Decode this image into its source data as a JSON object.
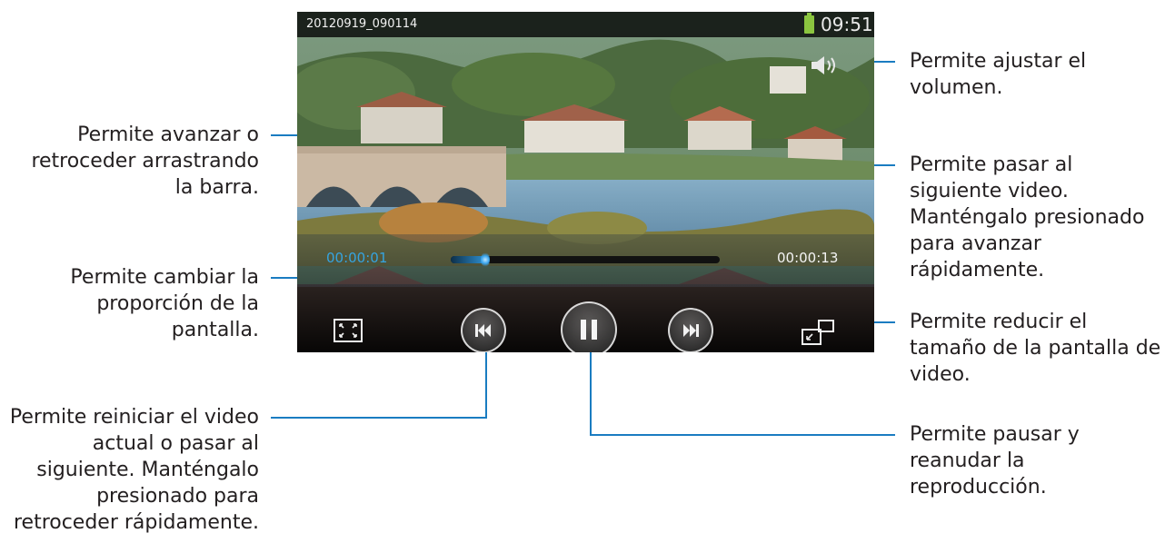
{
  "video": {
    "filename": "20120919_090114",
    "clock": "09:51",
    "current_time": "00:00:01",
    "total_time": "00:00:13",
    "progress_fraction": 0.13
  },
  "annotations": {
    "volume": [
      "Permite ajustar el",
      "volumen."
    ],
    "seek": [
      "Permite avanzar o",
      "retroceder arrastrando",
      "la barra."
    ],
    "next": [
      "Permite pasar al",
      "siguiente video.",
      "Manténgalo presionado",
      "para avanzar",
      "rápidamente."
    ],
    "aspect": [
      "Permite cambiar la",
      "proporción de la",
      "pantalla."
    ],
    "popup": [
      "Permite reducir el",
      "tamaño de la pantalla de",
      "video."
    ],
    "prev": [
      "Permite reiniciar el video",
      "actual o pasar al",
      "siguiente. Manténgalo",
      "presionado para",
      "retroceder rápidamente."
    ],
    "pause": [
      "Permite pausar y",
      "reanudar la",
      "reproducción."
    ]
  },
  "icons": {
    "volume": "speaker-icon",
    "aspect": "aspect-ratio-icon",
    "prev": "skip-previous-icon",
    "pause": "pause-icon",
    "next": "skip-next-icon",
    "popup": "pop-up-player-icon",
    "battery": "battery-icon"
  },
  "colors": {
    "leader_line": "#1a7cc1",
    "progress": "#2e8fd0",
    "current_time": "#35a4e0",
    "battery": "#8bc53f"
  }
}
